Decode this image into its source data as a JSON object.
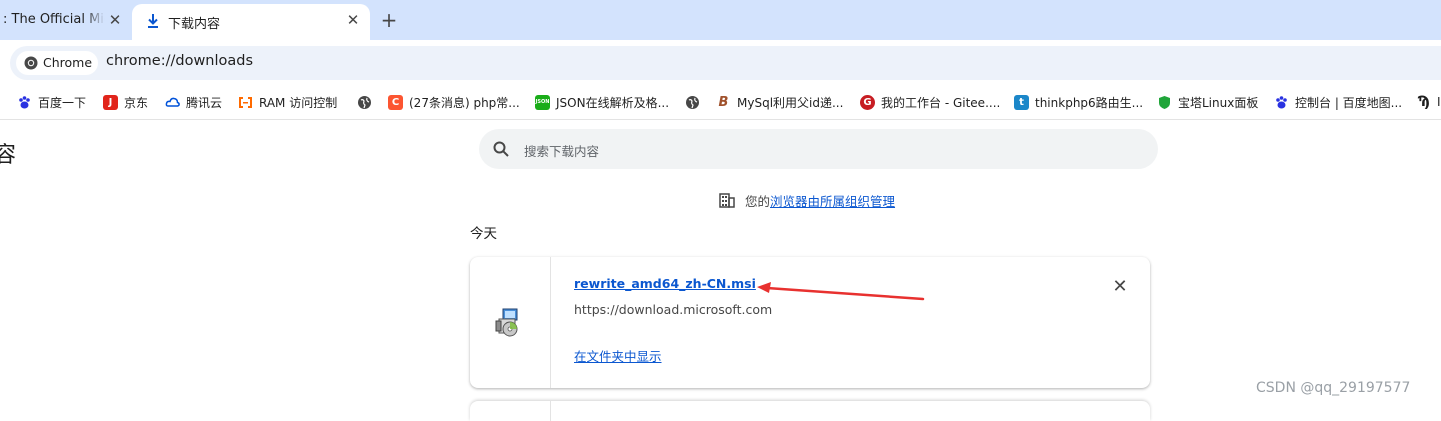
{
  "tabs": [
    {
      "title": ": The Official Mic",
      "active": false
    },
    {
      "title": "下载内容",
      "active": true
    }
  ],
  "toolbar": {
    "chip_label": "Chrome",
    "url": "chrome://downloads"
  },
  "bookmarks": [
    {
      "label": "百度一下",
      "icon": "baidu-paw-icon",
      "color": "#2932e1"
    },
    {
      "label": "京东",
      "icon": "jd-icon",
      "color": "#e1251b"
    },
    {
      "label": "腾讯云",
      "icon": "tencent-cloud-icon",
      "color": "#0052d9"
    },
    {
      "label": "RAM 访问控制",
      "icon": "aliyun-icon",
      "color": "#ff6a00"
    },
    {
      "label": "",
      "icon": "globe-icon",
      "color": "#474747"
    },
    {
      "label": "(27条消息) php常...",
      "icon": "csdn-icon",
      "color": "#fc5531"
    },
    {
      "label": "JSON在线解析及格...",
      "icon": "json-icon",
      "color": "#1aad19"
    },
    {
      "label": "",
      "icon": "globe-icon",
      "color": "#474747"
    },
    {
      "label": "MySql利用父id递...",
      "icon": "mysql-icon",
      "color": "#a0522d"
    },
    {
      "label": "我的工作台 - Gitee....",
      "icon": "gitee-icon",
      "color": "#c71d23"
    },
    {
      "label": "thinkphp6路由生...",
      "icon": "thinkphp-icon",
      "color": "#1b87c9"
    },
    {
      "label": "宝塔Linux面板",
      "icon": "bt-shield-icon",
      "color": "#20a53a"
    },
    {
      "label": "控制台 | 百度地图...",
      "icon": "baidu-map-icon",
      "color": "#2932e1"
    },
    {
      "label": "I",
      "icon": "edge-icon",
      "color": "#1f1f1f"
    }
  ],
  "page": {
    "title_partial": "容",
    "search_placeholder": "搜索下载内容",
    "managed_prefix": "您的",
    "managed_link": "浏览器由所属组织管理",
    "date_header": "今天"
  },
  "download": {
    "file_name": "rewrite_amd64_zh-CN.msi",
    "source_url": "https://download.microsoft.com",
    "show_in_folder": "在文件夹中显示"
  },
  "watermark": "CSDN @qq_29197577",
  "colors": {
    "tabstrip": "#d3e3fd",
    "omnibox": "#edf2fa",
    "link": "#0b57d0",
    "arrow": "#e8312f"
  }
}
